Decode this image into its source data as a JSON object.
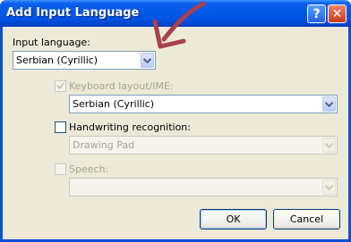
{
  "window": {
    "title": "Add Input Language",
    "help_label": "?",
    "close_label": "✕"
  },
  "input_language": {
    "label": "Input language:",
    "value": "Serbian (Cyrillic)"
  },
  "keyboard_layout": {
    "label": "Keyboard layout/IME:",
    "checked": true,
    "value": "Serbian (Cyrillic)"
  },
  "handwriting": {
    "label": "Handwriting recognition:",
    "checked": false,
    "value": "Drawing Pad"
  },
  "speech": {
    "label": "Speech:",
    "checked": false,
    "value": ""
  },
  "buttons": {
    "ok": "OK",
    "cancel": "Cancel"
  },
  "colors": {
    "titlebar": "#0054e3",
    "window_bg": "#ece9d8",
    "annotation_arrow": "#a8404e"
  }
}
